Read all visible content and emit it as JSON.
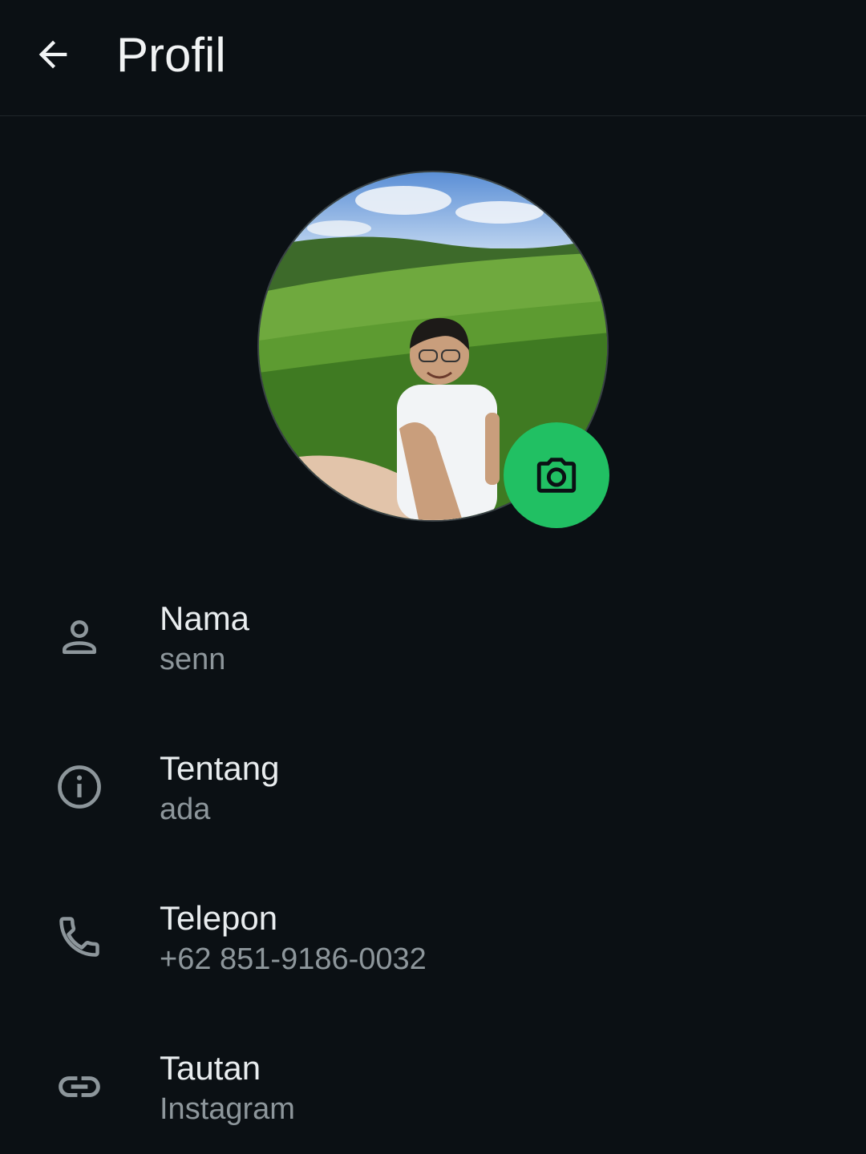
{
  "header": {
    "title": "Profil",
    "back_icon": "arrow-left-icon"
  },
  "avatar": {
    "camera_icon": "camera-icon",
    "camera_button_color": "#21c063"
  },
  "fields": [
    {
      "label": "Nama",
      "value": "senn",
      "icon": "person-icon"
    },
    {
      "label": "Tentang",
      "value": "ada",
      "icon": "info-icon"
    },
    {
      "label": "Telepon",
      "value": "+62 851-9186-0032",
      "icon": "phone-icon"
    },
    {
      "label": "Tautan",
      "value": "Instagram",
      "icon": "link-icon"
    }
  ],
  "colors": {
    "background": "#0b1014",
    "accent": "#21c063",
    "primary_text": "#e9edef",
    "secondary_text": "#8d969b"
  }
}
